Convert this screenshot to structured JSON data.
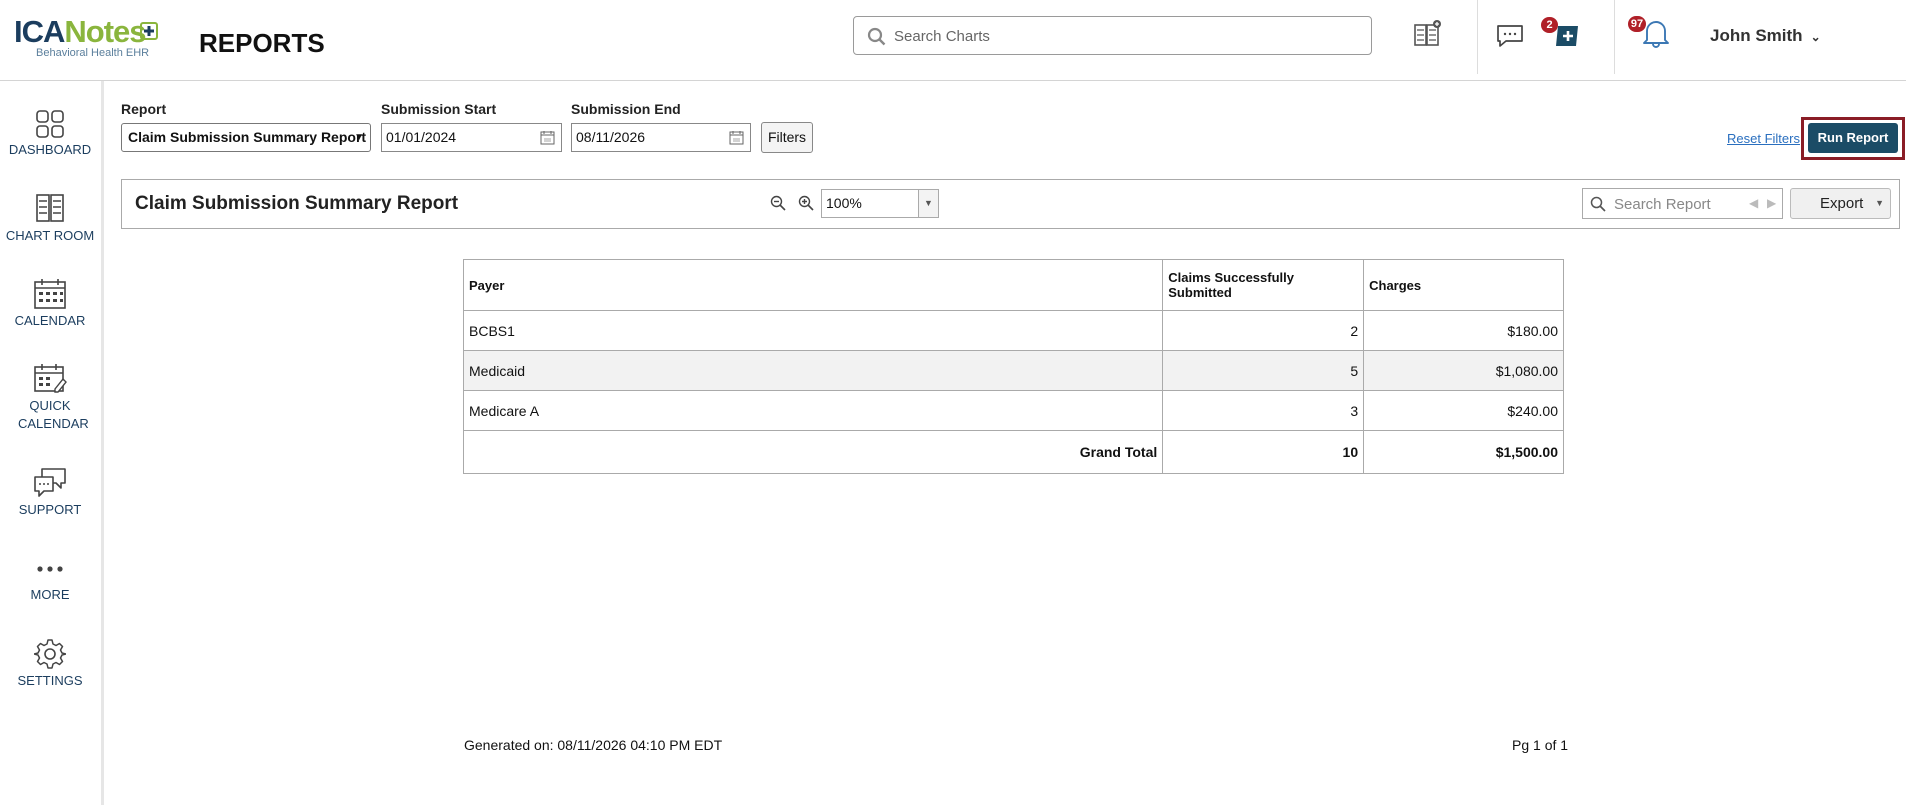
{
  "app": {
    "logo_brand_a": "ICA",
    "logo_brand_b": "Notes",
    "logo_tagline": "Behavioral Health EHR",
    "page_title": "REPORTS"
  },
  "header": {
    "search_placeholder": "Search Charts",
    "messages_badge": "2",
    "notifications_badge": "97",
    "user_name": "John Smith"
  },
  "sidebar": {
    "items": [
      {
        "label": "DASHBOARD",
        "icon": "dashboard-icon"
      },
      {
        "label": "CHART ROOM",
        "icon": "chart-room-icon"
      },
      {
        "label": "CALENDAR",
        "icon": "calendar-icon"
      },
      {
        "label": "QUICK CALENDAR",
        "icon": "quick-calendar-icon"
      },
      {
        "label": "SUPPORT",
        "icon": "support-icon"
      },
      {
        "label": "MORE",
        "icon": "more-icon"
      },
      {
        "label": "SETTINGS",
        "icon": "gear-icon"
      }
    ]
  },
  "filters": {
    "report_label": "Report",
    "report_value": "Claim Submission Summary Report",
    "start_label": "Submission Start",
    "start_value": "01/01/2024",
    "end_label": "Submission End",
    "end_value": "08/11/2026",
    "filters_button": "Filters",
    "reset_filters": "Reset Filters",
    "run_report": "Run Report"
  },
  "viewer": {
    "title": "Claim Submission Summary Report",
    "zoom": "100%",
    "search_placeholder": "Search Report",
    "export_label": "Export"
  },
  "table": {
    "headers": [
      "Payer",
      "Claims Successfully Submitted",
      "Charges"
    ],
    "rows": [
      [
        "BCBS1",
        "2",
        "$180.00"
      ],
      [
        "Medicaid",
        "5",
        "$1,080.00"
      ],
      [
        "Medicare A",
        "3",
        "$240.00"
      ]
    ],
    "total": [
      "Grand Total",
      "10",
      "$1,500.00"
    ]
  },
  "footer": {
    "generated": "Generated on: 08/11/2026 04:10 PM EDT",
    "page": "Pg 1 of 1"
  },
  "colors": {
    "brand_navy": "#1b3d5e",
    "brand_green": "#8ab53d",
    "run_button": "#1b4c66",
    "run_outline": "#8a1d26",
    "badge": "#b02028",
    "link": "#2a6fbf"
  }
}
